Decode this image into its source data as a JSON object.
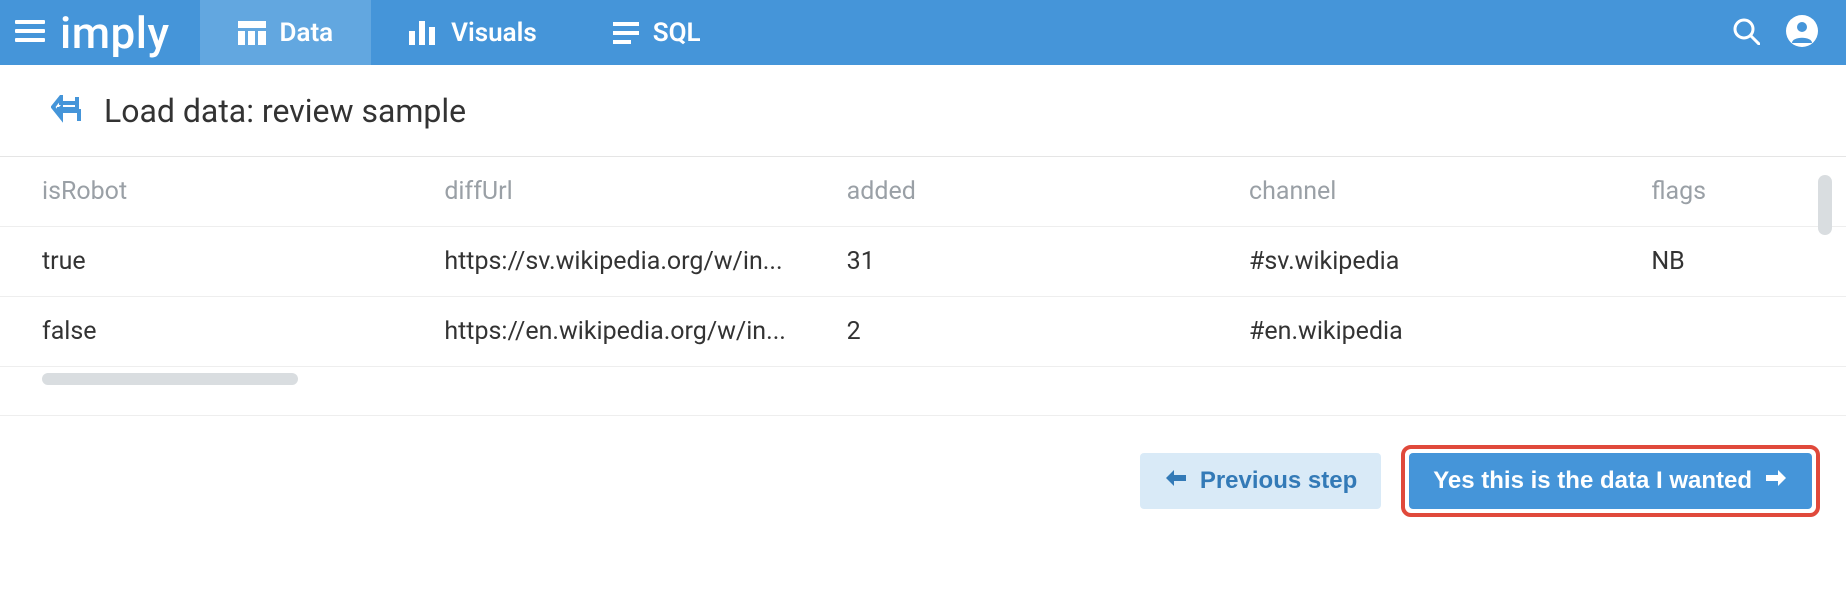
{
  "brand": "imply",
  "nav": {
    "data": {
      "label": "Data",
      "active": true
    },
    "visuals": {
      "label": "Visuals",
      "active": false
    },
    "sql": {
      "label": "SQL",
      "active": false
    }
  },
  "page": {
    "title": "Load data: review sample"
  },
  "table": {
    "columns": {
      "isRobot": "isRobot",
      "diffUrl": "diffUrl",
      "added": "added",
      "channel": "channel",
      "flags": "flags"
    },
    "rows": [
      {
        "isRobot": "true",
        "diffUrl": "https://sv.wikipedia.org/w/in...",
        "added": "31",
        "channel": "#sv.wikipedia",
        "flags": "NB"
      },
      {
        "isRobot": "false",
        "diffUrl": "https://en.wikipedia.org/w/in...",
        "added": "2",
        "channel": "#en.wikipedia",
        "flags": ""
      }
    ]
  },
  "footer": {
    "prev": "Previous step",
    "confirm": "Yes this is the data I wanted"
  }
}
